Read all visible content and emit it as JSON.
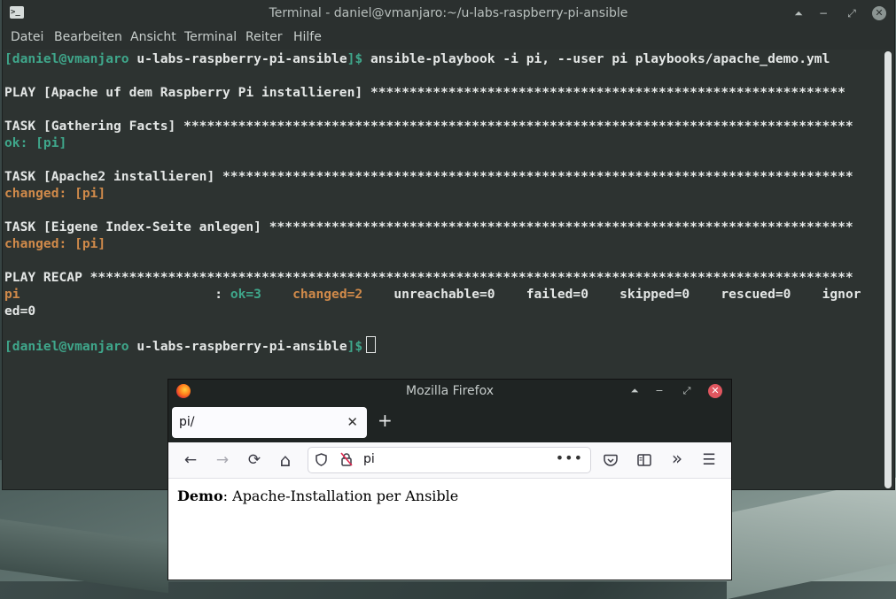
{
  "terminal": {
    "title": "Terminal - daniel@vmanjaro:~/u-labs-raspberry-pi-ansible",
    "menu": [
      "Datei",
      "Bearbeiten",
      "Ansicht",
      "Terminal",
      "Reiter",
      "Hilfe"
    ],
    "window_buttons": {
      "keep_above": "⏶",
      "minimize": "−",
      "maximize": "⤢",
      "close": "✕"
    },
    "lines": {
      "prompt1_user": "[daniel@vmanjaro",
      "prompt1_dir": " u-labs-raspberry-pi-ansible",
      "prompt1_end": "]$ ",
      "command": "ansible-playbook -i pi, --user pi playbooks/apache_demo.yml",
      "play": "PLAY [Apache uf dem Raspberry Pi installieren] *************************************************************",
      "task1": "TASK [Gathering Facts] **************************************************************************************",
      "task1_result": "ok: [pi]",
      "task2": "TASK [Apache2 installieren] *********************************************************************************",
      "task2_result": "changed: [pi]",
      "task3": "TASK [Eigene Index-Seite anlegen] ***************************************************************************",
      "task3_result": "changed: [pi]",
      "recap": "PLAY RECAP **************************************************************************************************",
      "recap_host": "pi",
      "recap_sep": "                         : ",
      "recap_ok": "ok=3",
      "recap_changed": "    changed=2",
      "recap_rest": "    unreachable=0    failed=0    skipped=0    rescued=0    ignor",
      "recap_wrap": "ed=0",
      "prompt2_user": "[daniel@vmanjaro",
      "prompt2_dir": " u-labs-raspberry-pi-ansible",
      "prompt2_end": "]$"
    }
  },
  "firefox": {
    "title": "Mozilla Firefox",
    "window_buttons": {
      "keep_above": "⏶",
      "minimize": "−",
      "maximize": "⤢",
      "close": "✕"
    },
    "tab_label": "pi/",
    "tab_close": "✕",
    "new_tab": "+",
    "nav": {
      "back": "←",
      "forward": "→",
      "reload": "⟳",
      "home": "⌂",
      "more": "»",
      "menu": "☰"
    },
    "url": "pi",
    "url_actions": "•••",
    "content_bold": "Demo",
    "content_rest": ": Apache-Installation per Ansible"
  }
}
